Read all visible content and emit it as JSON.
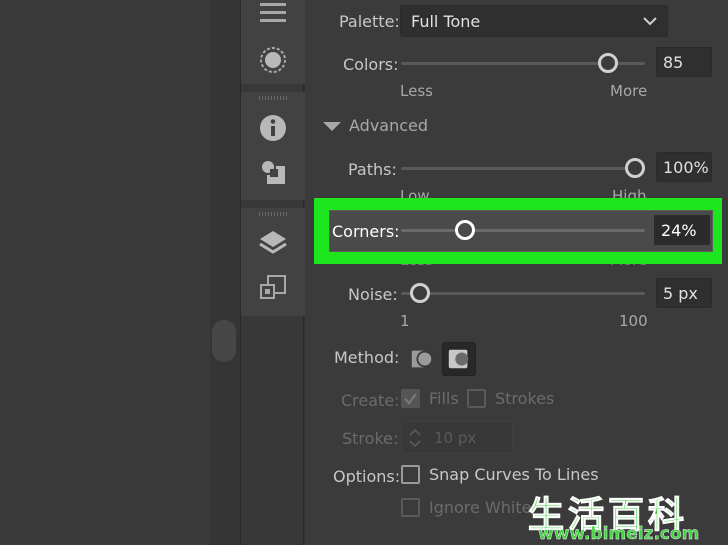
{
  "panel": {
    "palette_label": "Palette:",
    "palette_value": "Full Tone",
    "colors_label": "Colors:",
    "colors_value": "85",
    "colors_min": "Less",
    "colors_max": "More",
    "colors_level": 0.88,
    "advanced_label": "Advanced",
    "paths_label": "Paths:",
    "paths_value": "100%",
    "paths_min": "Low",
    "paths_max": "High",
    "paths_level": 1.0,
    "corners_label": "Corners:",
    "corners_value": "24%",
    "corners_min": "Less",
    "corners_max": "More",
    "corners_level": 0.24,
    "noise_label": "Noise:",
    "noise_value": "5 px",
    "noise_min": "1",
    "noise_max": "100",
    "noise_level": 0.04,
    "method_label": "Method:",
    "create_label": "Create:",
    "fills_label": "Fills",
    "strokes_label": "Strokes",
    "stroke_label": "Stroke:",
    "stroke_value": "10 px",
    "options_label": "Options:",
    "snap_label": "Snap Curves To Lines",
    "ignore_label": "Ignore White"
  },
  "watermark": {
    "chinese": "生活百科",
    "url": "www.bimeiz.com"
  },
  "colors": {
    "highlight": "#1ee61e",
    "panel_bg": "#3b3b3b"
  },
  "icons": [
    "hamburger-icon",
    "dashed-circle-icon",
    "info-icon",
    "shape-icon",
    "layers-icon",
    "artboards-icon",
    "chevron-down-icon",
    "triangle-down-icon",
    "method-abutting-icon",
    "method-overlapping-icon",
    "stepper-arrows-icon"
  ]
}
